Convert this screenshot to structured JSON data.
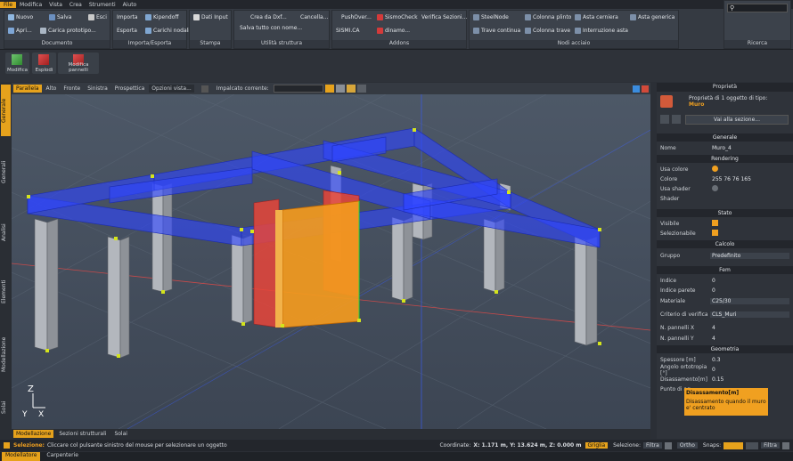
{
  "menu": [
    "File",
    "Modifica",
    "Vista",
    "Crea",
    "Strumenti",
    "Aiuto"
  ],
  "ribbon": {
    "documento": {
      "label": "Documento",
      "nuovo": "Nuovo",
      "salva": "Salva",
      "esci": "Esci",
      "apri": "Apri...",
      "carica": "Carica prototipo..."
    },
    "importa": {
      "label": "Importa/Esporta",
      "importa": "Importa",
      "esporta": "Esporta",
      "kipendoff": "Kipendoff",
      "carichi": "Carichi nodali"
    },
    "stampa": {
      "label": "Stampa",
      "dati": "Dati Input"
    },
    "utilita": {
      "label": "Utilità struttura",
      "crea": "Crea da Dxf...",
      "cancella": "Cancella...",
      "salva_nome": "Salva tutto con nome..."
    },
    "addons": {
      "label": "Addons",
      "pushover": "PushOver...",
      "sismocheck": "SismoCheck",
      "verifica": "Verifica Sezioni...",
      "sismica": "SISMI.CA",
      "dinamo": "dinamo..."
    },
    "nodi": {
      "label": "Nodi acciaio",
      "steelnode": "SteelNode",
      "colonna_plinto": "Colonna plinto",
      "asta_cerniera": "Asta cerniera",
      "asta_generica": "Asta generica",
      "trave_continua": "Trave continua",
      "colonna_trave": "Colonna trave",
      "interruzione": "Interruzione asta"
    },
    "ricerca": {
      "label": "Ricerca"
    }
  },
  "secbar": {
    "modifica": "Modifica",
    "esplodi": "Esplodi",
    "modifica_pannelli": "Modifica pannelli"
  },
  "viewtabs": [
    "Parallela",
    "Alto",
    "Fronte",
    "Sinistra",
    "Prospettica"
  ],
  "opzioni": "Opzioni vista...",
  "impalcato": "Impalcato corrente:",
  "sidetabs": [
    "Generale",
    "Generali",
    "Analisi",
    "Elementi",
    "Modellazione",
    "Solai"
  ],
  "btabs": [
    "Modellazione",
    "Sezioni strutturali",
    "Solai"
  ],
  "props": {
    "title": "Proprietà",
    "desc1": "Proprietà di 1 oggetto di tipo:",
    "desc2": "Muro",
    "goto": "Vai alla sezione...",
    "sections": {
      "generale": "Generale",
      "rendering": "Rendering",
      "stato": "Stato",
      "calcolo": "Calcolo",
      "fem": "Fem",
      "geometria": "Geometria"
    },
    "nome": [
      "Nome",
      "Muro_4"
    ],
    "usa_colore": [
      "Usa colore",
      ""
    ],
    "colore": [
      "Colore",
      "255 76 76 165"
    ],
    "usa_shader": [
      "Usa shader",
      ""
    ],
    "shader": [
      "Shader",
      ""
    ],
    "visibile": [
      "Visibile",
      ""
    ],
    "selezionabile": [
      "Selezionabile",
      ""
    ],
    "gruppo": [
      "Gruppo",
      "Predefinito"
    ],
    "indice": [
      "Indice",
      "0"
    ],
    "indice_parete": [
      "Indice parete",
      "0"
    ],
    "materiale": [
      "Materiale",
      "C25/30"
    ],
    "criterio": [
      "Criterio di verifica",
      "CLS_Muri"
    ],
    "npx": [
      "N. pannelli X",
      "4"
    ],
    "npy": [
      "N. pannelli Y",
      "4"
    ],
    "spessore": [
      "Spessore [m]",
      "0.3"
    ],
    "angolo": [
      "Angolo ortotropia [°]",
      "0"
    ],
    "disassamento": [
      "Disassamento[m]",
      "0.15"
    ],
    "punto": [
      "Punto di ag",
      ""
    ]
  },
  "tooltip": {
    "title": "Disassamento[m]",
    "text": "Disassamento quando il muro e' centrato"
  },
  "status": {
    "sel_label": "Selezione:",
    "sel_text": "Cliccare col pulsante sinistro del mouse per selezionare un oggetto",
    "coord_label": "Coordinate:",
    "coord": "X: 1.171 m, Y: 13.624 m, Z: 0.000 m",
    "griglia": "Griglia",
    "selezione": "Selezione:",
    "filtra": "Filtra",
    "ortho": "Ortho",
    "snaps": "Snaps:",
    "filtra2": "Filtra"
  },
  "apptabs": [
    "Modellatore",
    "Carpenterie"
  ],
  "axes": {
    "x": "X",
    "y": "Y",
    "z": "Z"
  }
}
